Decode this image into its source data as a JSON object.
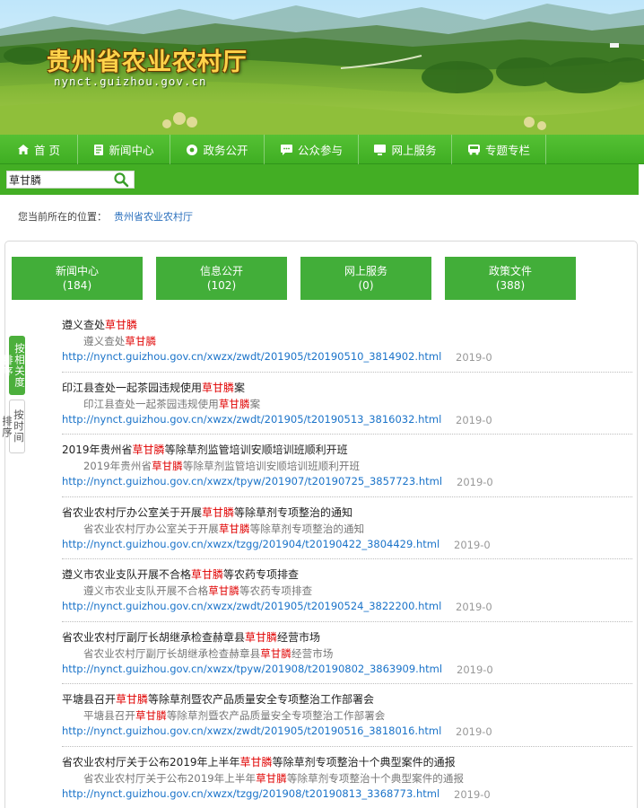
{
  "site": {
    "title": "贵州省农业农村厅",
    "domain": "nynct.guizhou.gov.cn"
  },
  "nav": {
    "items": [
      {
        "label": "首 页",
        "icon": "home-icon"
      },
      {
        "label": "新闻中心",
        "icon": "document-icon"
      },
      {
        "label": "政务公开",
        "icon": "settings-icon"
      },
      {
        "label": "公众参与",
        "icon": "chat-icon"
      },
      {
        "label": "网上服务",
        "icon": "monitor-icon"
      },
      {
        "label": "专题专栏",
        "icon": "bus-icon"
      }
    ]
  },
  "search": {
    "value": "草甘膦",
    "button_icon": "search-icon"
  },
  "breadcrumb": {
    "label": "您当前所在的位置：",
    "link": "贵州省农业农村厅"
  },
  "categories": [
    {
      "label": "新闻中心",
      "count": "(184)"
    },
    {
      "label": "信息公开",
      "count": "(102)"
    },
    {
      "label": "网上服务",
      "count": "(0)"
    },
    {
      "label": "政策文件",
      "count": "(388)"
    }
  ],
  "sort": {
    "relevance": "按相关度排序",
    "time": "按时间排序"
  },
  "keyword": "草甘膦",
  "results": [
    {
      "title": "遵义查处草甘膦",
      "snippet": "遵义查处草甘膦",
      "url": "http://nynct.guizhou.gov.cn/xwzx/zwdt/201905/t20190510_3814902.html",
      "date": "2019-0"
    },
    {
      "title": "印江县查处一起茶园违规使用草甘膦案",
      "snippet": "印江县查处一起茶园违规使用草甘膦案",
      "url": "http://nynct.guizhou.gov.cn/xwzx/zwdt/201905/t20190513_3816032.html",
      "date": "2019-0"
    },
    {
      "title": "2019年贵州省草甘膦等除草剂监管培训安顺培训班顺利开班",
      "snippet": "2019年贵州省草甘膦等除草剂监管培训安顺培训班顺利开班",
      "url": "http://nynct.guizhou.gov.cn/xwzx/tpyw/201907/t20190725_3857723.html",
      "date": "2019-0"
    },
    {
      "title": "省农业农村厅办公室关于开展草甘膦等除草剂专项整治的通知",
      "snippet": "省农业农村厅办公室关于开展草甘膦等除草剂专项整治的通知",
      "url": "http://nynct.guizhou.gov.cn/xwzx/tzgg/201904/t20190422_3804429.html",
      "date": "2019-0"
    },
    {
      "title": "遵义市农业支队开展不合格草甘膦等农药专项排查",
      "snippet": "遵义市农业支队开展不合格草甘膦等农药专项排查",
      "url": "http://nynct.guizhou.gov.cn/xwzx/zwdt/201905/t20190524_3822200.html",
      "date": "2019-0"
    },
    {
      "title": "省农业农村厅副厅长胡继承检查赫章县草甘膦经营市场",
      "snippet": "省农业农村厅副厅长胡继承检查赫章县草甘膦经营市场",
      "url": "http://nynct.guizhou.gov.cn/xwzx/tpyw/201908/t20190802_3863909.html",
      "date": "2019-0"
    },
    {
      "title": "平塘县召开草甘膦等除草剂暨农产品质量安全专项整治工作部署会",
      "snippet": "平塘县召开草甘膦等除草剂暨农产品质量安全专项整治工作部署会",
      "url": "http://nynct.guizhou.gov.cn/xwzx/zwdt/201905/t20190516_3818016.html",
      "date": "2019-0"
    },
    {
      "title": "省农业农村厅关于公布2019年上半年草甘膦等除草剂专项整治十个典型案件的通报",
      "snippet": "省农业农村厅关于公布2019年上半年草甘膦等除草剂专项整治十个典型案件的通报",
      "url": "http://nynct.guizhou.gov.cn/xwzx/tzgg/201908/t20190813_3368773.html",
      "date": "2019-0"
    }
  ]
}
